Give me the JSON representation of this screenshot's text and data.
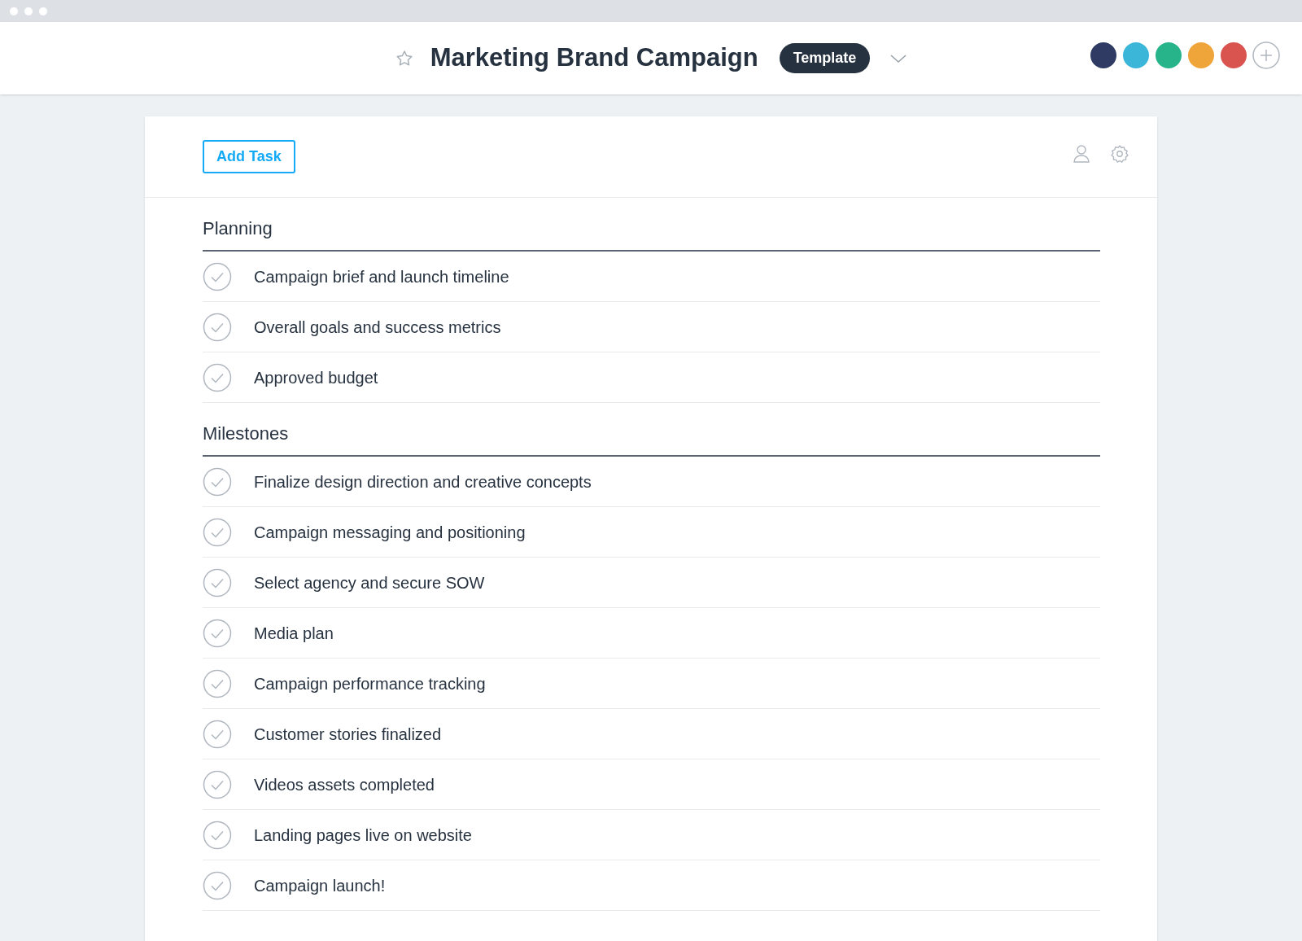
{
  "header": {
    "title": "Marketing Brand Campaign",
    "starred": false,
    "badge": "Template"
  },
  "avatars": [
    {
      "color": "#2f3b63"
    },
    {
      "color": "#3bb6d8"
    },
    {
      "color": "#27b48a"
    },
    {
      "color": "#f0a53a"
    },
    {
      "color": "#d9534f"
    }
  ],
  "toolbar": {
    "add_button": "Add Task"
  },
  "sections": [
    {
      "title": "Planning",
      "tasks": [
        {
          "label": "Campaign brief and launch timeline",
          "completed": false
        },
        {
          "label": "Overall goals and success metrics",
          "completed": false
        },
        {
          "label": "Approved budget",
          "completed": false
        }
      ]
    },
    {
      "title": "Milestones",
      "tasks": [
        {
          "label": "Finalize design direction and creative concepts",
          "completed": false
        },
        {
          "label": "Campaign messaging and positioning",
          "completed": false
        },
        {
          "label": "Select agency and secure SOW",
          "completed": false
        },
        {
          "label": "Media plan",
          "completed": false
        },
        {
          "label": "Campaign performance tracking",
          "completed": false
        },
        {
          "label": "Customer stories finalized",
          "completed": false
        },
        {
          "label": "Videos assets completed",
          "completed": false
        },
        {
          "label": "Landing pages live on website",
          "completed": false
        },
        {
          "label": "Campaign launch!",
          "completed": false
        }
      ]
    }
  ]
}
